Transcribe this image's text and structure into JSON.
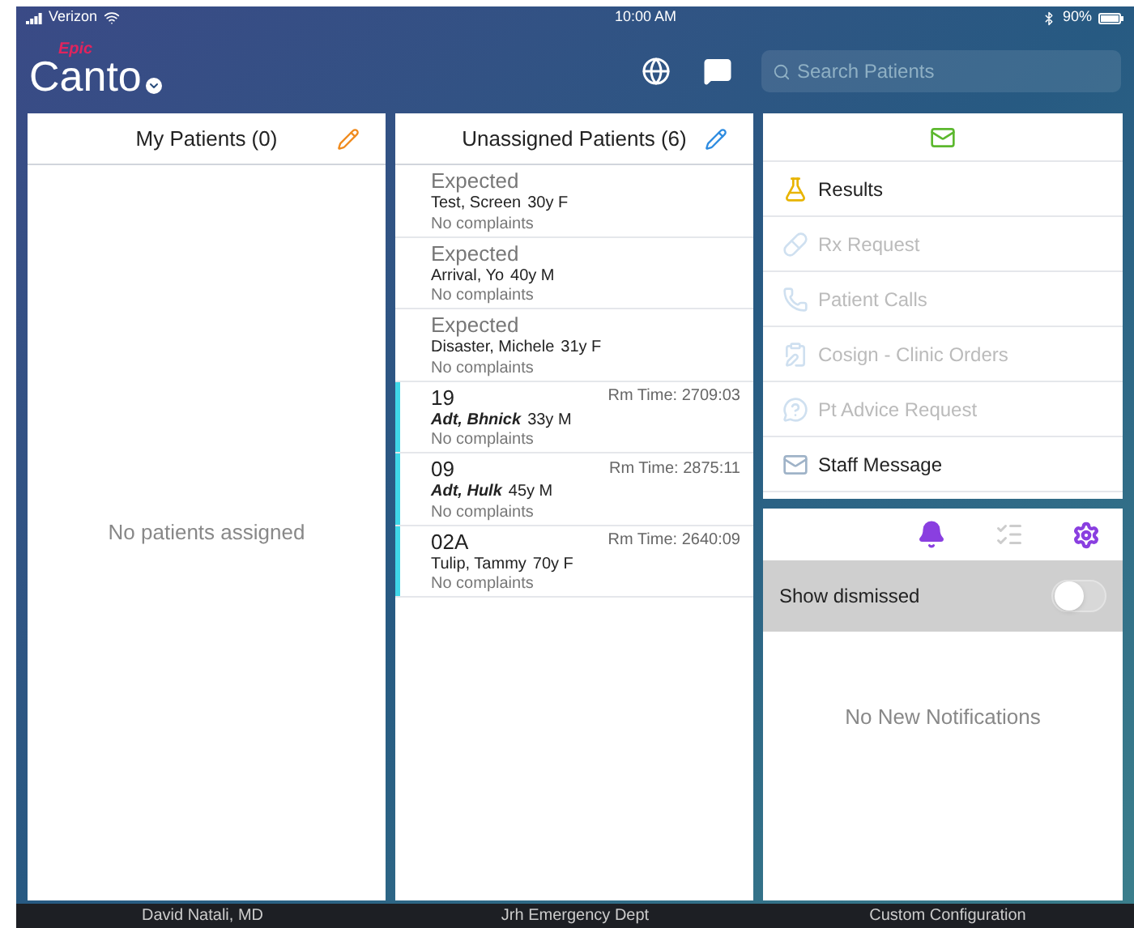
{
  "status_bar": {
    "carrier": "Verizon",
    "time": "10:00 AM",
    "battery": "90%"
  },
  "header": {
    "logo_badge": "Epic",
    "logo": "Canto",
    "search": {
      "placeholder": "Search Patients"
    }
  },
  "my_patients": {
    "title": "My Patients (0)",
    "empty": "No patients assigned"
  },
  "unassigned": {
    "title": "Unassigned Patients (6)",
    "rows": [
      {
        "kind": "expected",
        "room": "Expected",
        "name": "Test, Screen",
        "age": "30y F",
        "complaint": "No complaints",
        "name_emphasis": false
      },
      {
        "kind": "expected",
        "room": "Expected",
        "name": "Arrival, Yo",
        "age": "40y M",
        "complaint": "No complaints",
        "name_emphasis": false
      },
      {
        "kind": "expected",
        "room": "Expected",
        "name": "Disaster, Michele",
        "age": "31y F",
        "complaint": "No complaints",
        "name_emphasis": false
      },
      {
        "kind": "roomed",
        "room": "19",
        "time": "Rm Time: 2709:03",
        "name": "Adt, Bhnick",
        "age": "33y M",
        "complaint": "No complaints",
        "name_emphasis": true
      },
      {
        "kind": "roomed",
        "room": "09",
        "time": "Rm Time: 2875:11",
        "name": "Adt, Hulk",
        "age": "45y M",
        "complaint": "No complaints",
        "name_emphasis": true
      },
      {
        "kind": "roomed",
        "room": "02A",
        "time": "Rm Time: 2640:09",
        "name": "Tulip, Tammy",
        "age": "70y F",
        "complaint": "No complaints",
        "name_emphasis": false
      }
    ]
  },
  "inbox": {
    "items": [
      {
        "kind": "results",
        "label": "Results",
        "disabled": false
      },
      {
        "kind": "rx",
        "label": "Rx Request",
        "disabled": true
      },
      {
        "kind": "calls",
        "label": "Patient Calls",
        "disabled": true
      },
      {
        "kind": "cosign",
        "label": "Cosign - Clinic Orders",
        "disabled": true
      },
      {
        "kind": "advice",
        "label": "Pt Advice Request",
        "disabled": true
      },
      {
        "kind": "staff",
        "label": "Staff Message",
        "disabled": false
      }
    ]
  },
  "notifications": {
    "tabs": [
      {
        "kind": "bell",
        "selected": true
      },
      {
        "kind": "checklist",
        "selected": false
      }
    ],
    "show_dismissed": {
      "label": "Show dismissed",
      "on": false
    },
    "empty": "No New Notifications"
  },
  "footer": [
    "David Natali, MD",
    "Jrh Emergency Dept",
    "Custom Configuration"
  ]
}
